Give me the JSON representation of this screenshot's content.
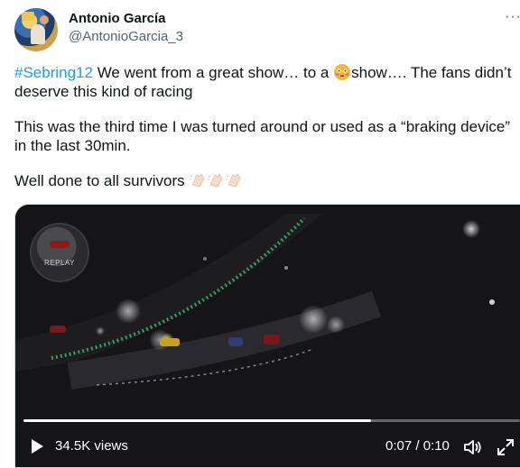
{
  "author": {
    "name": "Antonio García",
    "handle": "@AntonioGarcia_3"
  },
  "more_label": "···",
  "tweet": {
    "hashtag": "#Sebring12",
    "line1_part1": " We went from a great show… to a ",
    "line1_emoji": "flushed-face-emoji",
    "line1_part2": "show…. The fans didn’t",
    "line2": "deserve this kind of racing",
    "para2_line1": "This was the third time I was turned around or used as a “braking device”",
    "para2_line2": "in the last 30min.",
    "para3": "Well done to all survivors",
    "para3_emoji": "clapping-hands-emoji"
  },
  "video": {
    "badge_label": "REPLAY",
    "views": "34.5K views",
    "time": "0:07 / 0:10",
    "progress_fraction": 0.7,
    "icons": [
      "play-icon",
      "volume-icon",
      "fullscreen-icon"
    ]
  },
  "colors": {
    "hashtag": "#1d9bf0",
    "secondary_text": "#536471",
    "border": "#cfd9de"
  }
}
